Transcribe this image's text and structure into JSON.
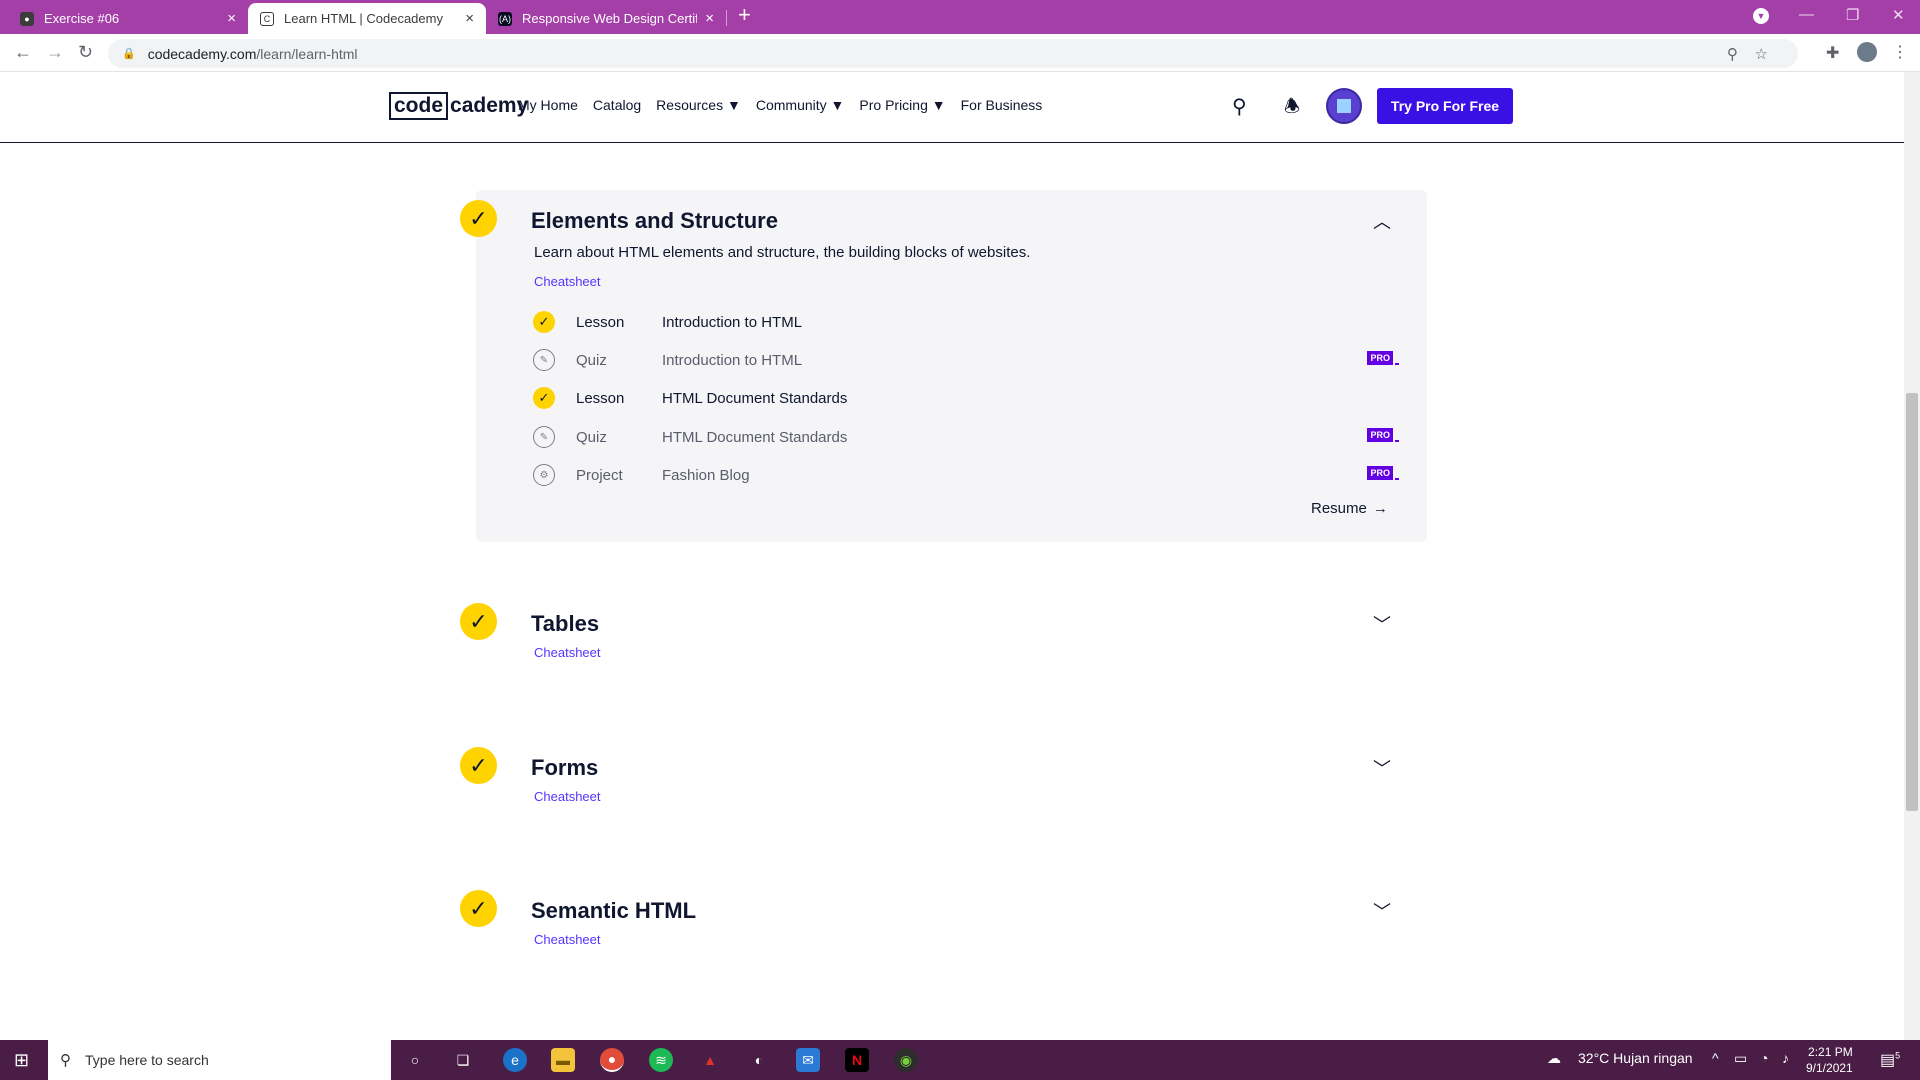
{
  "browser": {
    "tabs": [
      {
        "title": "Exercise #06",
        "active": false
      },
      {
        "title": "Learn HTML | Codecademy",
        "active": true
      },
      {
        "title": "Responsive Web Design Certificat",
        "active": false
      }
    ],
    "new_tab": "+",
    "url_domain": "codecademy.com",
    "url_path": "/learn/learn-html",
    "accent_color": "#a33fa6"
  },
  "header": {
    "logo_code": "code",
    "logo_cademy": "cademy",
    "nav": [
      "My Home",
      "Catalog",
      "Resources ▼",
      "Community ▼",
      "Pro Pricing ▼",
      "For Business"
    ],
    "cta": "Try Pro For Free",
    "cta_color": "#3a10e5"
  },
  "syllabus": {
    "expanded": {
      "title": "Elements and Structure",
      "description": "Learn about HTML elements and structure, the building blocks of websites.",
      "cheatsheet": "Cheatsheet",
      "items": [
        {
          "type": "Lesson",
          "name": "Introduction to HTML",
          "done": true,
          "pro": ""
        },
        {
          "type": "Quiz",
          "name": "Introduction to HTML",
          "done": false,
          "pro": "PRO"
        },
        {
          "type": "Lesson",
          "name": "HTML Document Standards",
          "done": true,
          "pro": ""
        },
        {
          "type": "Quiz",
          "name": "HTML Document Standards",
          "done": false,
          "pro": "PRO"
        },
        {
          "type": "Project",
          "name": "Fashion Blog",
          "done": false,
          "pro": "PRO"
        }
      ],
      "resume": "Resume"
    },
    "collapsed": [
      {
        "title": "Tables",
        "cheatsheet": "Cheatsheet"
      },
      {
        "title": "Forms",
        "cheatsheet": "Cheatsheet"
      },
      {
        "title": "Semantic HTML",
        "cheatsheet": "Cheatsheet"
      }
    ]
  },
  "taskbar": {
    "search_placeholder": "Type here to search",
    "weather": "32°C  Hujan ringan",
    "time": "2:21 PM",
    "date": "9/1/2021",
    "notification_count": "5"
  }
}
